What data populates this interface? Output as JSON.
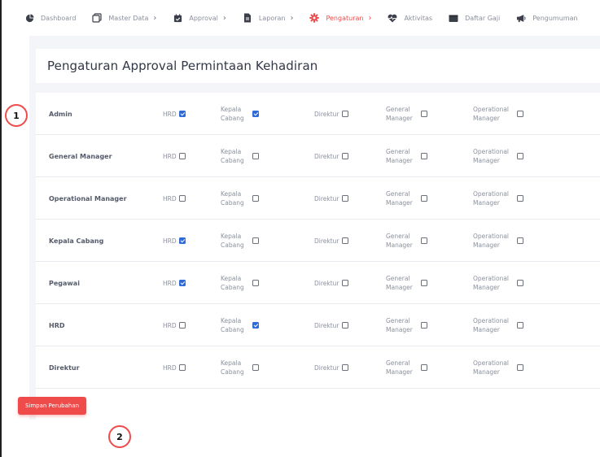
{
  "nav": {
    "items": [
      {
        "label": "Dashboard",
        "icon": "dashboard-icon",
        "chevron": false,
        "active": false
      },
      {
        "label": "Master Data",
        "icon": "master-data-icon",
        "chevron": true,
        "active": false
      },
      {
        "label": "Approval",
        "icon": "calendar-check-icon",
        "chevron": true,
        "active": false
      },
      {
        "label": "Laporan",
        "icon": "document-icon",
        "chevron": true,
        "active": false
      },
      {
        "label": "Pengaturan",
        "icon": "gear-icon",
        "chevron": true,
        "active": true
      },
      {
        "label": "Aktivitas",
        "icon": "heartbeat-icon",
        "chevron": false,
        "active": false
      },
      {
        "label": "Daftar Gaji",
        "icon": "wallet-icon",
        "chevron": false,
        "active": false
      },
      {
        "label": "Pengumuman",
        "icon": "megaphone-icon",
        "chevron": false,
        "active": false
      }
    ],
    "chevron_glyph": "›"
  },
  "page": {
    "title": "Pengaturan Approval Permintaan Kehadiran"
  },
  "columns": [
    {
      "key": "hrd",
      "label": "HRD"
    },
    {
      "key": "kepala_cabang",
      "label": "Kepala Cabang",
      "line1": "Kepala",
      "line2": "Cabang"
    },
    {
      "key": "direktur",
      "label": "Direktur"
    },
    {
      "key": "general_manager",
      "label": "General Manager",
      "line1": "General",
      "line2": "Manager"
    },
    {
      "key": "operational_manager",
      "label": "Operational Manager",
      "line1": "Operational",
      "line2": "Manager"
    }
  ],
  "rows": [
    {
      "role": "Admin",
      "checked": {
        "hrd": true,
        "kepala_cabang": true,
        "direktur": false,
        "general_manager": false,
        "operational_manager": false
      }
    },
    {
      "role": "General Manager",
      "checked": {
        "hrd": false,
        "kepala_cabang": false,
        "direktur": false,
        "general_manager": false,
        "operational_manager": false
      }
    },
    {
      "role": "Operational Manager",
      "checked": {
        "hrd": false,
        "kepala_cabang": false,
        "direktur": false,
        "general_manager": false,
        "operational_manager": false
      }
    },
    {
      "role": "Kepala Cabang",
      "checked": {
        "hrd": true,
        "kepala_cabang": false,
        "direktur": false,
        "general_manager": false,
        "operational_manager": false
      }
    },
    {
      "role": "Pegawai",
      "checked": {
        "hrd": true,
        "kepala_cabang": false,
        "direktur": false,
        "general_manager": false,
        "operational_manager": false
      }
    },
    {
      "role": "HRD",
      "checked": {
        "hrd": false,
        "kepala_cabang": true,
        "direktur": false,
        "general_manager": false,
        "operational_manager": false
      }
    },
    {
      "role": "Direktur",
      "checked": {
        "hrd": false,
        "kepala_cabang": false,
        "direktur": false,
        "general_manager": false,
        "operational_manager": false
      }
    }
  ],
  "save_button": {
    "label": "Simpan Perubahan"
  },
  "markers": [
    "1",
    "2"
  ],
  "colors": {
    "accent": "#f04b4b",
    "checkbox_checked": "#2f6bd8"
  }
}
